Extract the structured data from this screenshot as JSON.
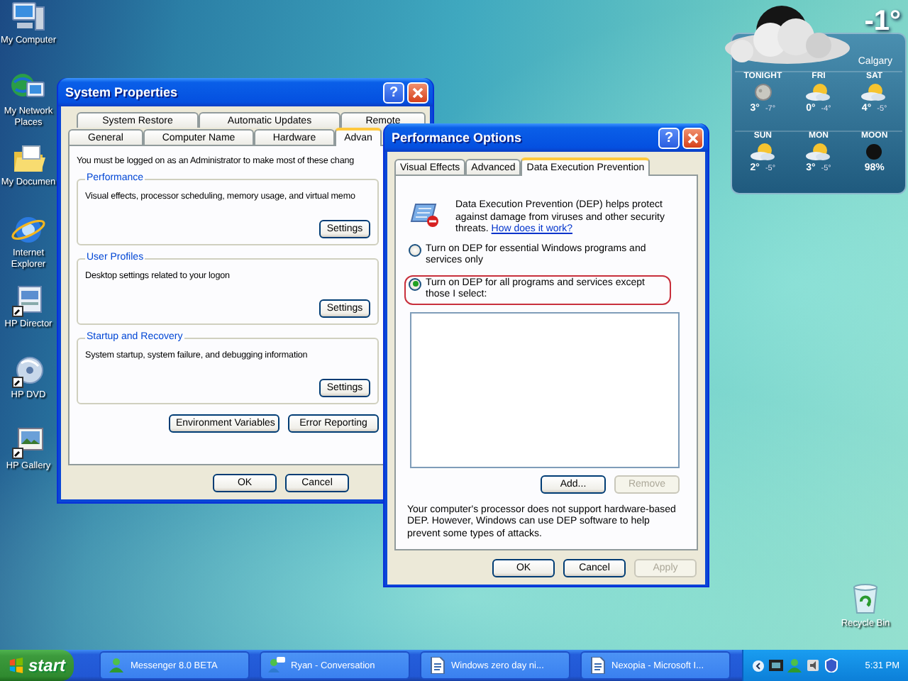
{
  "desktop_icons": [
    {
      "label": "My Computer",
      "kind": "computer"
    },
    {
      "label": "My Network Places",
      "kind": "network"
    },
    {
      "label": "My Documen",
      "kind": "folder"
    },
    {
      "label": "Internet Explorer",
      "kind": "browser"
    },
    {
      "label": "HP Director",
      "kind": "director"
    },
    {
      "label": "HP DVD",
      "kind": "dvd"
    },
    {
      "label": "HP Gallery",
      "kind": "gallery"
    }
  ],
  "recycle_bin": {
    "label": "Recycle Bin"
  },
  "weather": {
    "temperature": "-1°",
    "city": "Calgary",
    "cells": [
      {
        "label": "TONIGHT",
        "kind": "moon",
        "high": "3°",
        "low": "-7°"
      },
      {
        "label": "FRI",
        "kind": "sun-cloud",
        "high": "0°",
        "low": "-4°"
      },
      {
        "label": "SAT",
        "kind": "sun-cloud",
        "high": "4°",
        "low": "-5°"
      },
      {
        "label": "SUN",
        "kind": "sun-cloud",
        "high": "2°",
        "low": "-5°"
      },
      {
        "label": "MON",
        "kind": "sun-cloud",
        "high": "3°",
        "low": "-5°"
      },
      {
        "label": "MOON",
        "kind": "new-moon",
        "reading": "98%"
      }
    ]
  },
  "system_properties": {
    "title": "System Properties",
    "help": "?",
    "tabs_back": [
      {
        "label": "System Restore",
        "selected": false
      },
      {
        "label": "Automatic Updates",
        "selected": false
      },
      {
        "label": "Remote",
        "selected": false
      }
    ],
    "tabs_front": [
      {
        "label": "General",
        "selected": false
      },
      {
        "label": "Computer Name",
        "selected": false
      },
      {
        "label": "Hardware",
        "selected": false
      },
      {
        "label": "Advan",
        "selected": true
      }
    ],
    "notice": "You must be logged on as an Administrator to make most of these chang",
    "groups": [
      {
        "title": "Performance",
        "text": "Visual effects, processor scheduling, memory usage, and virtual memo",
        "button": "Settings"
      },
      {
        "title": "User Profiles",
        "text": "Desktop settings related to your logon",
        "button": "Settings"
      },
      {
        "title": "Startup and Recovery",
        "text": "System startup, system failure, and debugging information",
        "button": "Settings"
      }
    ],
    "panel_buttons": [
      "Environment Variables",
      "Error Reporting"
    ],
    "dialog_buttons": [
      "OK",
      "Cancel"
    ]
  },
  "performance_options": {
    "title": "Performance Options",
    "help": "?",
    "tabs": [
      {
        "label": "Visual Effects",
        "selected": false
      },
      {
        "label": "Advanced",
        "selected": false
      },
      {
        "label": "Data Execution Prevention",
        "selected": true
      }
    ],
    "intro": "Data Execution Prevention (DEP) helps protect against damage from viruses and other security threats.",
    "intro_link": "How does it work?",
    "options": [
      {
        "label": "Turn on DEP for essential Windows programs and services only",
        "selected": false,
        "highlighted": false
      },
      {
        "label": "Turn on DEP for all programs and services except those I select:",
        "selected": true,
        "highlighted": true
      }
    ],
    "list_buttons": [
      {
        "label": "Add...",
        "disabled": false
      },
      {
        "label": "Remove",
        "disabled": true
      }
    ],
    "note": "Your computer's processor does not support hardware-based DEP. However, Windows can use DEP software to help prevent some types of attacks.",
    "dialog_buttons": [
      {
        "label": "OK",
        "disabled": false
      },
      {
        "label": "Cancel",
        "disabled": false
      },
      {
        "label": "Apply",
        "disabled": true
      }
    ]
  },
  "taskbar": {
    "start": "start",
    "tasks": [
      {
        "label": "Messenger 8.0 BETA",
        "kind": "messenger"
      },
      {
        "label": "Ryan - Conversation",
        "kind": "conversation"
      },
      {
        "label": "Windows zero day ni...",
        "kind": "document"
      },
      {
        "label": "Nexopia - Microsoft I...",
        "kind": "document"
      }
    ],
    "clock": "5:31 PM"
  }
}
